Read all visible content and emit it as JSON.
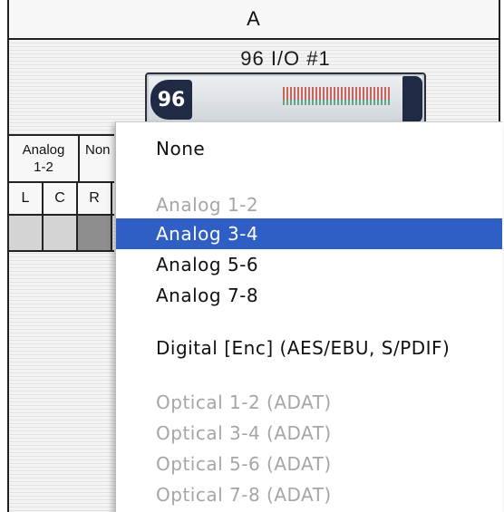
{
  "column": {
    "label": "A"
  },
  "device": {
    "title": "96 I/O #1",
    "badge": "96"
  },
  "io_headers": {
    "first_line1": "Analog",
    "first_line2": "1-2",
    "second": "Non"
  },
  "channels": [
    "L",
    "C",
    "R"
  ],
  "menu": {
    "items": [
      {
        "label": "None",
        "state": "normal"
      },
      {
        "label": "Analog 1-2",
        "state": "disabled"
      },
      {
        "label": "Analog 3-4",
        "state": "selected"
      },
      {
        "label": "Analog 5-6",
        "state": "normal"
      },
      {
        "label": "Analog 7-8",
        "state": "normal"
      },
      {
        "label": "Digital [Enc] (AES/EBU, S/PDIF)",
        "state": "normal"
      },
      {
        "label": "Optical 1-2 (ADAT)",
        "state": "disabled"
      },
      {
        "label": "Optical 3-4 (ADAT)",
        "state": "disabled"
      },
      {
        "label": "Optical 5-6 (ADAT)",
        "state": "disabled"
      },
      {
        "label": "Optical 7-8 (ADAT)",
        "state": "disabled"
      }
    ]
  },
  "colors": {
    "selection": "#2f5fc4",
    "disabled_text": "#a6a6a6"
  }
}
